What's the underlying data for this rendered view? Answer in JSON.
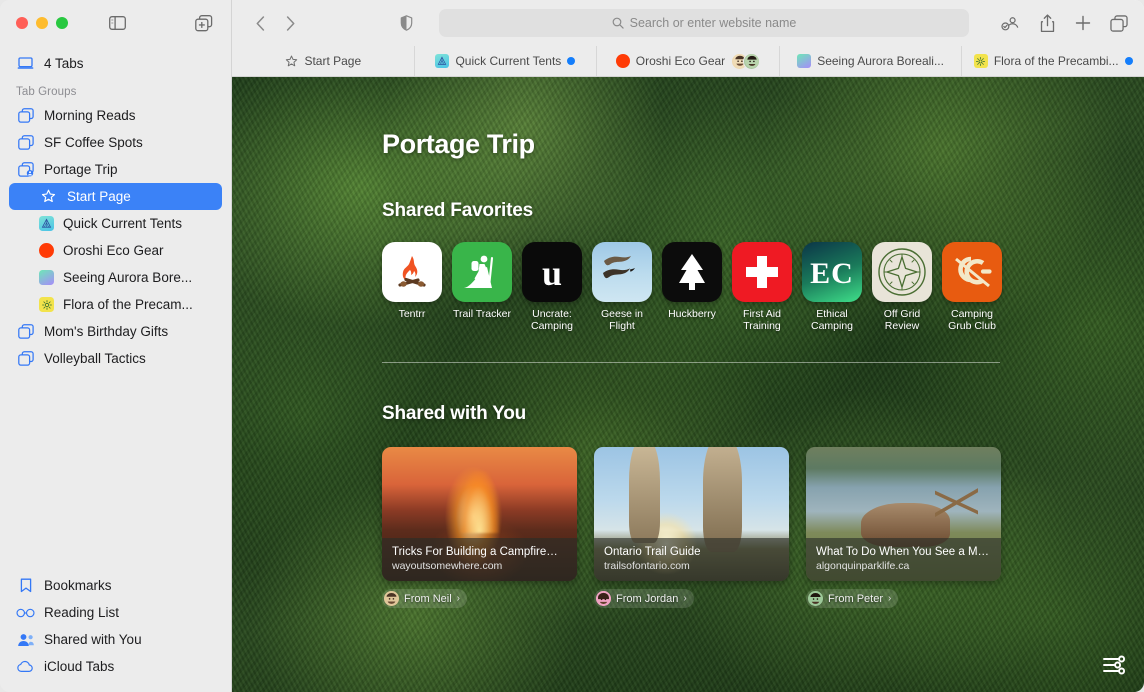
{
  "window": {
    "traffic_lights": [
      "close",
      "minimize",
      "zoom"
    ],
    "sidebar_toggle_icon": "sidebar-icon",
    "new_tab_group_icon": "new-tab-group-icon"
  },
  "sidebar": {
    "all_tabs": {
      "label": "4 Tabs",
      "icon": "laptop-icon"
    },
    "group_header": "Tab Groups",
    "groups": [
      {
        "label": "Morning Reads",
        "icon": "tab-group-icon",
        "selected": false
      },
      {
        "label": "SF Coffee Spots",
        "icon": "tab-group-icon",
        "selected": false
      },
      {
        "label": "Portage Trip",
        "icon": "tab-group-shared-icon",
        "selected": false
      }
    ],
    "portage_tabs": [
      {
        "label": "Start Page",
        "icon": "star-icon",
        "selected": true
      },
      {
        "label": "Quick Current Tents",
        "icon": "site-favicon-tents",
        "selected": false
      },
      {
        "label": "Oroshi Eco Gear",
        "icon": "site-favicon-oroshi",
        "selected": false
      },
      {
        "label": "Seeing Aurora Bore...",
        "icon": "site-favicon-aurora",
        "selected": false
      },
      {
        "label": "Flora of the Precam...",
        "icon": "site-favicon-flora",
        "selected": false
      }
    ],
    "groups_after": [
      {
        "label": "Mom's Birthday Gifts",
        "icon": "tab-group-icon"
      },
      {
        "label": "Volleyball Tactics",
        "icon": "tab-group-icon"
      }
    ],
    "bottom_items": [
      {
        "label": "Bookmarks",
        "icon": "bookmark-icon"
      },
      {
        "label": "Reading List",
        "icon": "glasses-icon"
      },
      {
        "label": "Shared with You",
        "icon": "people-icon"
      },
      {
        "label": "iCloud Tabs",
        "icon": "cloud-icon"
      }
    ]
  },
  "toolbar": {
    "back_icon": "chevron-left-icon",
    "forward_icon": "chevron-right-icon",
    "shield_icon": "privacy-shield-icon",
    "address_placeholder": "Search or enter website name",
    "search_icon": "search-icon",
    "right_icons": [
      "share-participants-icon",
      "share-icon",
      "new-tab-icon",
      "tab-overview-icon"
    ]
  },
  "tabs": [
    {
      "label": "Start Page",
      "icon": "star-icon",
      "active": true,
      "badge": "none",
      "avatars": []
    },
    {
      "label": "Quick Current Tents",
      "icon": "site-favicon-tents",
      "active": false,
      "badge": "blue-dot",
      "avatars": []
    },
    {
      "label": "Oroshi Eco Gear",
      "icon": "site-favicon-oroshi",
      "active": false,
      "badge": "none",
      "avatars": [
        "person-1",
        "person-2"
      ]
    },
    {
      "label": "Seeing Aurora Boreali...",
      "icon": "site-favicon-aurora",
      "active": false,
      "badge": "none",
      "avatars": []
    },
    {
      "label": "Flora of the Precambi...",
      "icon": "site-favicon-flora",
      "active": false,
      "badge": "blue-dot",
      "avatars": []
    }
  ],
  "start_page": {
    "title": "Portage Trip",
    "favorites_heading": "Shared Favorites",
    "favorites": [
      {
        "label": "Tentrr",
        "icon": "campfire-icon"
      },
      {
        "label": "Trail Tracker",
        "icon": "hiker-icon"
      },
      {
        "label": "Uncrate: Camping",
        "icon": "letter-u-icon"
      },
      {
        "label": "Geese in Flight",
        "icon": "geese-photo-icon"
      },
      {
        "label": "Huckberry",
        "icon": "pine-tree-icon"
      },
      {
        "label": "First Aid Training",
        "icon": "first-aid-cross-icon"
      },
      {
        "label": "Ethical Camping",
        "icon": "ec-monogram-icon"
      },
      {
        "label": "Off Grid Review",
        "icon": "compass-icon"
      },
      {
        "label": "Camping Grub Club",
        "icon": "cg-monogram-icon"
      }
    ],
    "shared_heading": "Shared with You",
    "shared_cards": [
      {
        "title": "Tricks For Building a Campfire—F...",
        "host": "wayoutsomewhere.com",
        "from": "From Neil",
        "chevron": "›",
        "image": "campfire-photo"
      },
      {
        "title": "Ontario Trail Guide",
        "host": "trailsofontario.com",
        "from": "From Jordan",
        "chevron": "›",
        "image": "hikers-photo"
      },
      {
        "title": "What To Do When You See a Moo...",
        "host": "algonquinparklife.ca",
        "from": "From Peter",
        "chevron": "›",
        "image": "moose-photo"
      }
    ],
    "settings_icon": "sliders-icon"
  },
  "colors": {
    "accent_blue": "#3b82f7",
    "sidebar_bg": "#ececec",
    "toolbar_bg": "#ececec",
    "blue_dot": "#147efb",
    "traffic_red": "#ff5f57",
    "traffic_yellow": "#febc2e",
    "traffic_green": "#28c840"
  }
}
